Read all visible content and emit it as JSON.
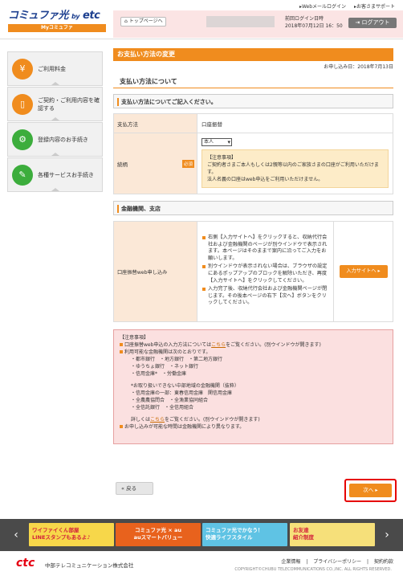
{
  "header": {
    "logo_main": "コミュファ光",
    "logo_by": "by",
    "logo_etc": "etc",
    "logo_sub": "Myコミュファ",
    "links": [
      "▸Webメールログイン",
      "▸お客さまサポート"
    ],
    "toppage_label": "トップページへ",
    "last_login_label": "前回ログイン日時",
    "last_login_value": "2018年07月12日 16：50",
    "logout_label": "ログアウト"
  },
  "sidebar": {
    "items": [
      {
        "label": "ご利用料金",
        "icon": "yen-icon",
        "color": "#f08c1e"
      },
      {
        "label": "ご契約・ご利用内容を確認する",
        "icon": "book-icon",
        "color": "#f08c1e"
      },
      {
        "label": "登録内容のお手続き",
        "icon": "gear-icon",
        "color": "#3cad3c"
      },
      {
        "label": "各種サービスお手続き",
        "icon": "document-icon",
        "color": "#3cad3c"
      }
    ]
  },
  "main": {
    "page_title": "お支払い方法の変更",
    "apply_date": "お申し込み日：2018年7月13日",
    "section_title": "支払い方法について",
    "sub_title": "支払い方法についてご記入ください。",
    "rows": [
      {
        "label": "支払方法",
        "value": "口座振替"
      },
      {
        "label": "続柄",
        "required": "必須",
        "select_value": "本人",
        "note_title": "【注意事項】",
        "note_lines": [
          "ご契約者さまご本人もしくは2親等以内のご家族さまの口座がご利用いただけます。",
          "法人名義の口座はweb申込をご利用いただけません。"
        ]
      }
    ],
    "bank_title": "金融機関、支店",
    "bank_row_label": "口座振替web申し込み",
    "bank_bullets": [
      "右側【入力サイトへ】をクリックすると、収納代行会社および金融機関のページが別ウインドウで表示されます。本ページはそのままで案内に沿ってご入力をお願いします。",
      "別ウインドウが表示されない場合は、ブラウザの設定にあるポップアップのブロックを解除いただき、再度【入力サイトへ】をクリックしてください。",
      "入力完了後、収納代行会社および金融機関ページが閉じます。その後本ページの右下【次へ】ボタンをクリックしてください。"
    ],
    "bank_note_title": "【注意事項】",
    "entry_btn": "入力サイトへ",
    "caution": {
      "title": "【注意事項】",
      "line1_a": "口座振替web申込の入力方法については",
      "line1_link": "こちら",
      "line1_b": "をご覧ください。(別ウインドウが開きます)",
      "line2": "利用可能な金融機関は次のとおりです。",
      "banks": [
        "・都市銀行　・地方銀行　・第二地方銀行",
        "・ゆうちょ銀行　・ネット銀行",
        "・信用金庫*　・労働金庫"
      ],
      "unavailable_title": "*お取り扱いできない中部地域の金融機関（抜粋）",
      "unavailable": [
        "・信用金庫の一部：東春信用金庫　関信用金庫",
        "・全農農協問合　・全漁業協同組合",
        "・全信託銀行　・全信用組合"
      ],
      "details_a": "詳しくは",
      "details_link": "こちら",
      "details_b": "をご覧ください。(別ウインドウが開きます)",
      "last": "お申し込みが可能な時間は金融機関により異なります。"
    },
    "back_label": "戻る",
    "next_label": "次へ"
  },
  "banners": [
    {
      "line1": "ワイファイくん部屋",
      "line2": "LINEスタンプもあるよ♪"
    },
    {
      "line1": "コミュファ光 × au",
      "line2": "auスマートバリュー"
    },
    {
      "line1": "コミュファ光でかなう！",
      "line2": "快適ライフスタイル"
    },
    {
      "line1": "お友達",
      "line2": "紹介制度"
    }
  ],
  "footer": {
    "logo": "ctc",
    "corp": "中部テレコミュニケーション株式会社",
    "links": [
      "企業情報",
      "プライバシーポリシー",
      "契約約款"
    ],
    "copyright": "COPYRIGHT©CHUBU TELECOMMUNICATIONS CO.,INC. ALL RIGHTS RESERVED."
  }
}
